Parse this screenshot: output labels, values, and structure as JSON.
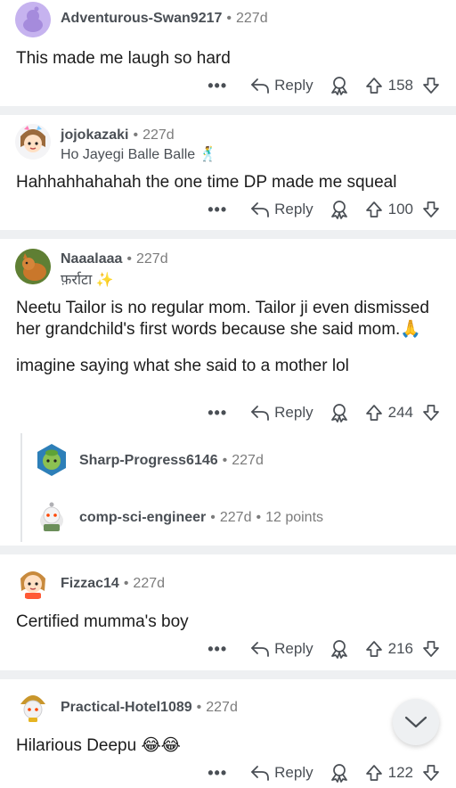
{
  "comments": [
    {
      "username": "Adventurous-Swan9217",
      "age": "227d",
      "body": [
        "This made me laugh so hard"
      ],
      "more": "•••",
      "reply_label": "Reply",
      "score": "158"
    },
    {
      "username": "jojokazaki",
      "age": "227d",
      "flair": "Ho Jayegi Balle Balle 🕺",
      "body": [
        "Hahhahhahahah the one time DP made me squeal"
      ],
      "more": "•••",
      "reply_label": "Reply",
      "score": "100"
    },
    {
      "username": "Naaalaaa",
      "age": "227d",
      "flair": "फ़र्राटा ✨",
      "body": [
        "Neetu Tailor  is no regular mom.  Tailor ji even dismissed  her grandchild's first words because she said mom.🙏",
        "imagine saying what she said to a mother lol"
      ],
      "more": "•••",
      "reply_label": "Reply",
      "score": "244",
      "children": [
        {
          "username": "Sharp-Progress6146",
          "age": "227d"
        },
        {
          "username": "comp-sci-engineer",
          "age": "227d",
          "points": "12 points"
        }
      ]
    },
    {
      "username": "Fizzac14",
      "age": "227d",
      "body": [
        "Certified mumma's boy"
      ],
      "more": "•••",
      "reply_label": "Reply",
      "score": "216"
    },
    {
      "username": "Practical-Hotel1089",
      "age": "227d",
      "body": [
        "Hilarious Deepu 😂😂"
      ],
      "more": "•••",
      "reply_label": "Reply",
      "score": "122"
    }
  ],
  "icons": {
    "reply": "reply-arrow-icon",
    "award": "award-icon",
    "upvote": "upvote-arrow-icon",
    "downvote": "downvote-arrow-icon",
    "scroll": "chevron-down-icon"
  },
  "colors": {
    "separator": "#eef0f2",
    "meta_text": "#4a4f55",
    "body_text": "#1c1c1c"
  }
}
